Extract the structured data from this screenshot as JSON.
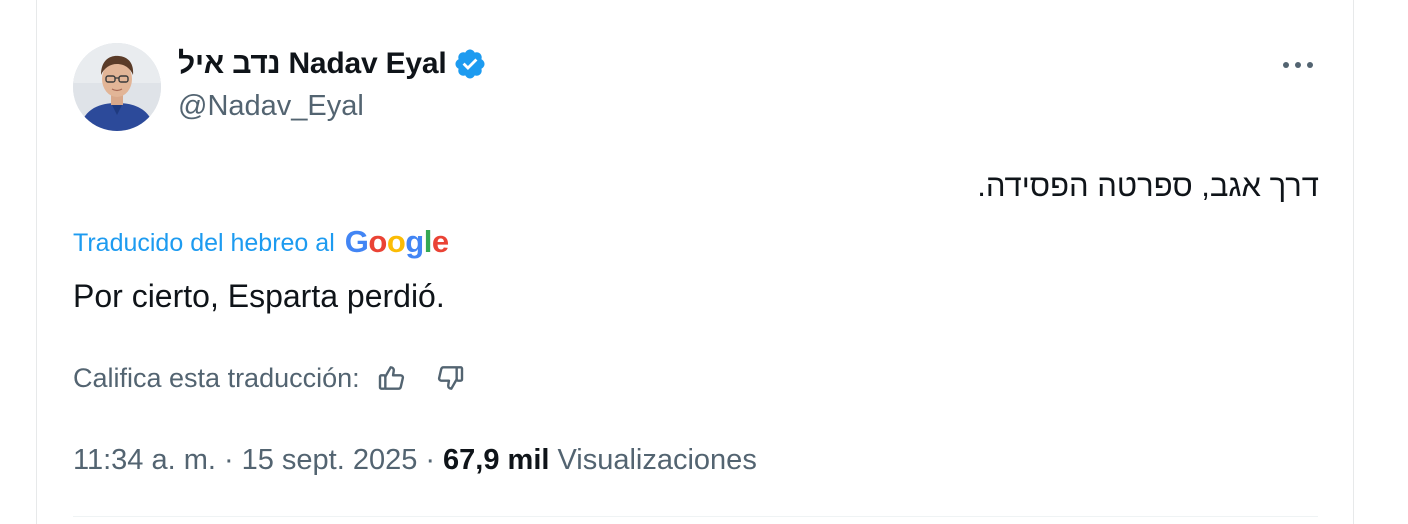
{
  "author": {
    "display_name": "נדב איל Nadav Eyal",
    "handle": "@Nadav_Eyal",
    "verified": true
  },
  "tweet": {
    "original_text": "דרך אגב, ספרטה הפסידה.",
    "translation_label": "Traducido del hebreo al",
    "translation_provider": "Google",
    "translated_text": "Por cierto, Esparta perdió.",
    "rate_label": "Califica esta traducción:"
  },
  "meta": {
    "time": "11:34 a. m.",
    "separator": "·",
    "date": "15 sept. 2025",
    "views_count": "67,9 mil",
    "views_label": "Visualizaciones"
  },
  "colors": {
    "link_blue": "#1d9bf0",
    "text_primary": "#0f1419",
    "text_secondary": "#536471",
    "verified_blue": "#1d9bf0"
  },
  "icons": {
    "verified": "verified-badge-icon",
    "more": "more-options-icon",
    "thumbs_up": "thumbs-up-icon",
    "thumbs_down": "thumbs-down-icon",
    "google": "google-logo"
  }
}
